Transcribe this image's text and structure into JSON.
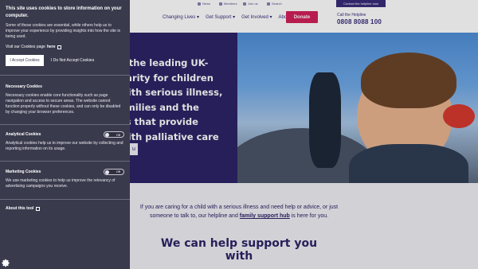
{
  "cookie_panel": {
    "title": "This site uses cookies to store information on your computer.",
    "intro": "Some of these cookies are essential, while others help us to improve your experience by providing insights into how the site is being used.",
    "cookies_page_prefix": "Visit our Cookies page",
    "cookies_page_link": "here",
    "accept_label": "I Accept Cookies",
    "reject_label": "I Do Not Accept Cookies",
    "necessary": {
      "title": "Necessary Cookies",
      "text": "Necessary cookies enable core functionality such as page navigation and access to secure areas. The website cannot function properly without these cookies, and can only be disabled by changing your browser preferences."
    },
    "analytical": {
      "title": "Analytical Cookies",
      "toggle_state": "Off",
      "text": "Analytical cookies help us to improve our website by collecting and reporting information on its usage."
    },
    "marketing": {
      "title": "Marketing Cookies",
      "toggle_state": "Off",
      "text": "We use marketing cookies to help us improve the relevancy of advertising campaigns you receive."
    },
    "about_label": "About this tool"
  },
  "site": {
    "utility": [
      "News",
      "Members",
      "Join us",
      "Search"
    ],
    "helpline_link": "Contact the helpline now",
    "nav": [
      "Changing Lives",
      "Get Support",
      "Get Involved",
      "About Us"
    ],
    "donate": "Donate",
    "call_label": "Call the Helpline",
    "call_number": "0808 8088 100",
    "hero_lines": [
      "e the leading UK-",
      "harity for children",
      "with serious illness,",
      "amilies and the",
      "es that provide",
      "with palliative care"
    ],
    "hero_button": "u",
    "intro_before": "If you are caring for a child with a serious illness and need help or advice, or just someone to talk to, our helpline and",
    "intro_link": "family support hub",
    "intro_after": "is here for you.",
    "section_heading": "We can help support you with"
  },
  "colors": {
    "brand_purple": "#2d2466",
    "donate_pink": "#d2215c",
    "panel_bg": "#3a3a4d"
  }
}
